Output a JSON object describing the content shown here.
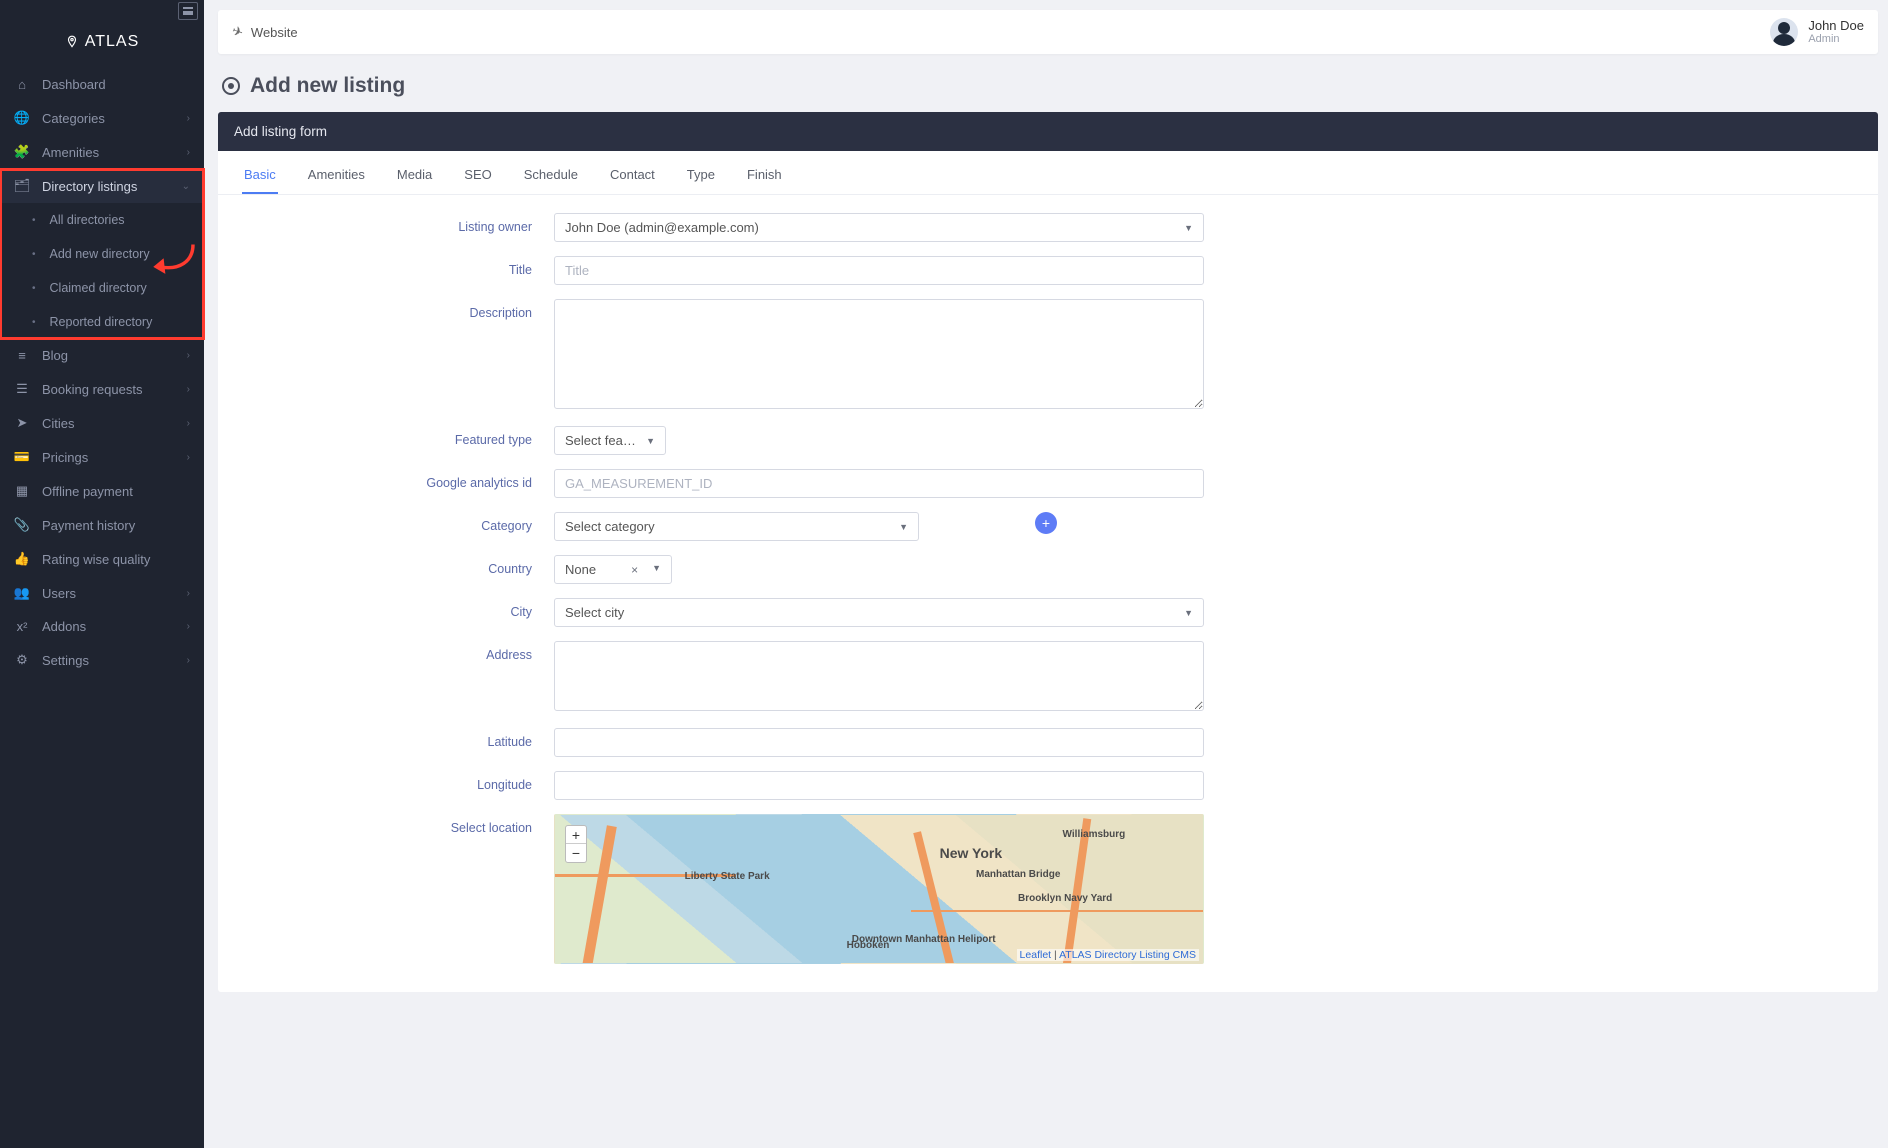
{
  "brand": "ATLAS",
  "topbar": {
    "website_label": "Website",
    "user_name": "John Doe",
    "user_role": "Admin"
  },
  "page_title": "Add new listing",
  "card_title": "Add listing form",
  "sidebar": [
    {
      "key": "dashboard",
      "icon": "home",
      "label": "Dashboard"
    },
    {
      "key": "categories",
      "icon": "globe",
      "label": "Categories",
      "chev": true
    },
    {
      "key": "amenities",
      "icon": "puzzle",
      "label": "Amenities",
      "chev": true
    },
    {
      "key": "directory",
      "icon": "tree",
      "label": "Directory listings",
      "chev": true,
      "active": true,
      "hilite": true,
      "children": [
        {
          "key": "all",
          "label": "All directories"
        },
        {
          "key": "add",
          "label": "Add new directory",
          "arrow": true
        },
        {
          "key": "claimed",
          "label": "Claimed directory"
        },
        {
          "key": "reported",
          "label": "Reported directory"
        }
      ]
    },
    {
      "key": "blog",
      "icon": "lines",
      "label": "Blog",
      "chev": true
    },
    {
      "key": "booking",
      "icon": "tune",
      "label": "Booking requests",
      "chev": true
    },
    {
      "key": "cities",
      "icon": "nav",
      "label": "Cities",
      "chev": true
    },
    {
      "key": "pricings",
      "icon": "card",
      "label": "Pricings",
      "chev": true
    },
    {
      "key": "offline",
      "icon": "box",
      "label": "Offline payment"
    },
    {
      "key": "payment",
      "icon": "clip",
      "label": "Payment history"
    },
    {
      "key": "rating",
      "icon": "thumb",
      "label": "Rating wise quality"
    },
    {
      "key": "users",
      "icon": "people",
      "label": "Users",
      "chev": true
    },
    {
      "key": "addons",
      "icon": "x2",
      "label": "Addons",
      "chev": true
    },
    {
      "key": "settings",
      "icon": "gears",
      "label": "Settings",
      "chev": true
    }
  ],
  "tabs": [
    "Basic",
    "Amenities",
    "Media",
    "SEO",
    "Schedule",
    "Contact",
    "Type",
    "Finish"
  ],
  "form": {
    "listing_owner": {
      "label": "Listing owner",
      "value": "John Doe (admin@example.com)"
    },
    "title": {
      "label": "Title",
      "placeholder": "Title"
    },
    "description": {
      "label": "Description"
    },
    "featured_type": {
      "label": "Featured type",
      "value": "Select featured ty…"
    },
    "ga_id": {
      "label": "Google analytics id",
      "placeholder": "GA_MEASUREMENT_ID"
    },
    "category": {
      "label": "Category",
      "value": "Select category"
    },
    "country": {
      "label": "Country",
      "value": "None"
    },
    "city": {
      "label": "City",
      "value": "Select city"
    },
    "address": {
      "label": "Address"
    },
    "latitude": {
      "label": "Latitude"
    },
    "longitude": {
      "label": "Longitude"
    },
    "select_location": {
      "label": "Select location"
    }
  },
  "map": {
    "zoom_in": "+",
    "zoom_out": "−",
    "labels": {
      "ny": "New York",
      "wb": "Williamsburg",
      "mb": "Manhattan Bridge",
      "bk": "Brooklyn Navy Yard",
      "ls": "Liberty State Park",
      "hb": "Hoboken",
      "mh": "Downtown Manhattan Heliport"
    },
    "attribution": {
      "leaflet": "Leaflet",
      "sep": " | ",
      "atlas": "ATLAS Directory Listing CMS"
    }
  },
  "icons": {
    "home": "⌂",
    "globe": "🌐",
    "puzzle": "🧩",
    "tree": "🗂",
    "lines": "≡",
    "tune": "☰",
    "nav": "➤",
    "card": "💳",
    "box": "▦",
    "clip": "📎",
    "thumb": "👍",
    "people": "👥",
    "x2": "x²",
    "gears": "⚙",
    "plane": "✈"
  }
}
